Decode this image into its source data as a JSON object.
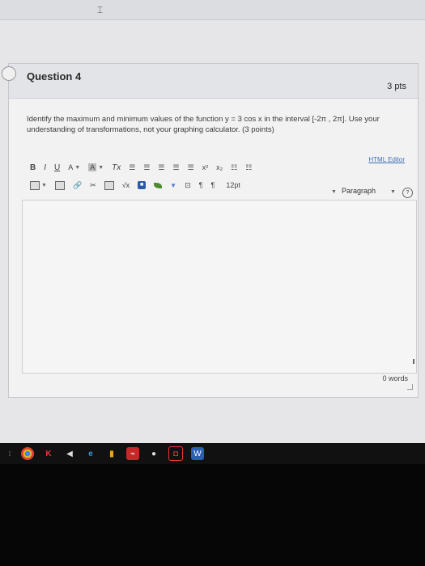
{
  "question": {
    "title": "Question 4",
    "points": "3 pts",
    "text": "Identify the maximum and minimum values of the function y = 3 cos x in the interval [-2π , 2π]. Use your understanding of transformations, not your graphing calculator. (3 points)"
  },
  "editor": {
    "html_editor_link": "HTML Editor",
    "toolbar_row1": {
      "bold": "B",
      "italic": "I",
      "underline": "U",
      "text_color": "A",
      "bg_color": "A",
      "clear_format": "Tx",
      "superscript": "x²",
      "subscript": "x₂"
    },
    "toolbar_row2": {
      "font_size": "12pt",
      "paragraph_select": "Paragraph",
      "pilcrow_ltr": "¶",
      "pilcrow_rtl": "¶",
      "sqrt": "√x"
    },
    "word_count": "0 words"
  },
  "taskbar": {
    "items": [
      "chrome",
      "k",
      "mail",
      "edge",
      "gold",
      "pdf",
      "chrome-2",
      "camera",
      "word"
    ]
  },
  "colors": {
    "link_blue": "#3c6fb6",
    "card_bg": "#f2f2f3",
    "taskbar_bg": "#111111"
  }
}
